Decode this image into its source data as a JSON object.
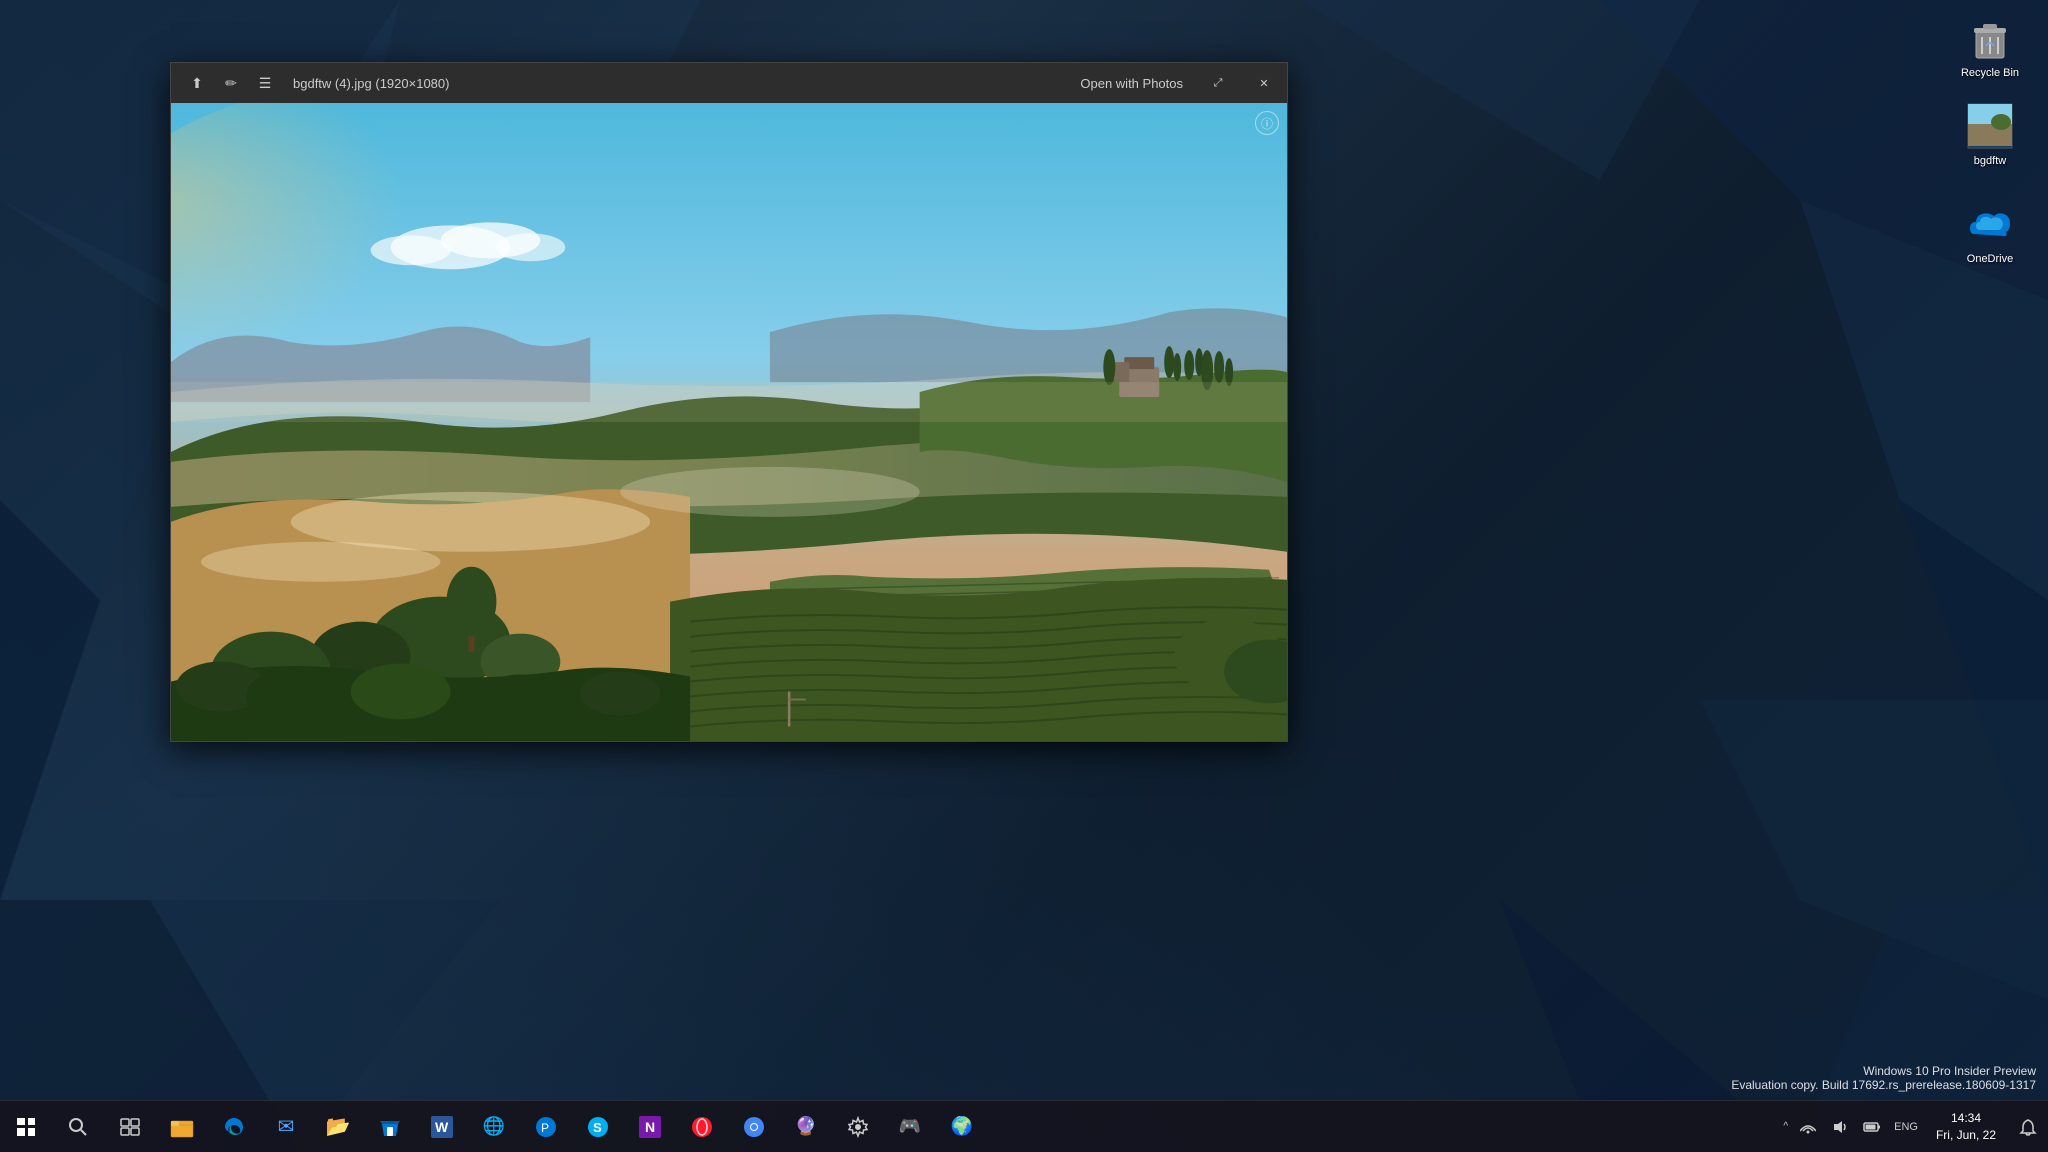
{
  "desktop": {
    "icons": [
      {
        "id": "recycle-bin",
        "label": "Recycle Bin",
        "emoji": "🗑️"
      },
      {
        "id": "bgdftw",
        "label": "bgdftw",
        "emoji": "🖼️"
      },
      {
        "id": "onedrive",
        "label": "OneDrive",
        "emoji": "☁️"
      }
    ]
  },
  "photo_window": {
    "title": "bgdftw (4).jpg (1920×1080)",
    "open_with_label": "Open with Photos",
    "toolbar_btns": [
      "⬆",
      "✏",
      "☰"
    ],
    "info_icon": "ⓘ",
    "close_label": "✕",
    "maximize_label": "□",
    "restore_label": "⤢"
  },
  "taskbar": {
    "start_label": "Start",
    "search_icon": "🔍",
    "taskview_icon": "⧉",
    "apps": [
      {
        "id": "file-explorer",
        "emoji": "📁",
        "active": false
      },
      {
        "id": "edge",
        "emoji": "🌐",
        "active": false
      },
      {
        "id": "mail",
        "emoji": "✉️",
        "active": false
      },
      {
        "id": "file-manager",
        "emoji": "🗂️",
        "active": false
      },
      {
        "id": "store",
        "emoji": "🛍️",
        "active": false
      },
      {
        "id": "word",
        "emoji": "W",
        "active": false
      },
      {
        "id": "unknown1",
        "emoji": "🌐",
        "active": false
      },
      {
        "id": "unknown2",
        "emoji": "⚙️",
        "active": false
      },
      {
        "id": "skype",
        "emoji": "S",
        "active": false
      },
      {
        "id": "onenote",
        "emoji": "N",
        "active": false
      },
      {
        "id": "opera",
        "emoji": "O",
        "active": false
      },
      {
        "id": "chrome",
        "emoji": "●",
        "active": false
      },
      {
        "id": "unknown3",
        "emoji": "🔮",
        "active": false
      },
      {
        "id": "settings",
        "emoji": "⚙️",
        "active": false
      },
      {
        "id": "unknown4",
        "emoji": "🎮",
        "active": false
      },
      {
        "id": "unknown5",
        "emoji": "🌍",
        "active": false
      }
    ],
    "tray": {
      "expand": "^",
      "network": "🌐",
      "volume": "🔊",
      "battery": "🔋",
      "lang": "ENG",
      "time": "14:34",
      "date": "Fri, Jun, 22"
    }
  },
  "watermark": {
    "line1": "Windows 10 Pro Insider Preview",
    "line2": "Evaluation copy. Build 17692.rs_prerelease.180609-1317"
  }
}
